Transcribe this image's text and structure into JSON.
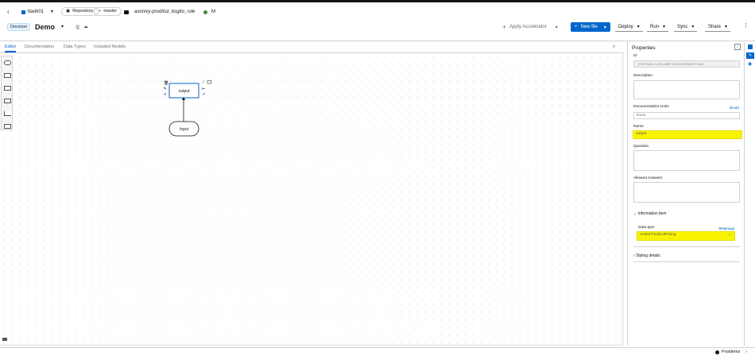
{
  "header": {
    "back_icon": "chevron-left-icon",
    "user": "ttanh01",
    "repo_label": "Repository",
    "branch": "master",
    "path": "axonivy-prod/luz_kogito_rule",
    "status_icon": "check-circle-icon",
    "status_text": "M"
  },
  "file": {
    "type_badge": "Decision",
    "name": "Demo"
  },
  "toolbar": {
    "apply_accelerator": "Apply Accelerator",
    "new_file": "New file",
    "deploy": "Deploy",
    "run": "Run",
    "sync": "Sync",
    "share": "Share"
  },
  "tabs": [
    "Editor",
    "Documentation",
    "Data Types",
    "Included Models"
  ],
  "diagram": {
    "decision_label": "output",
    "input_label": "Input"
  },
  "properties": {
    "title": "Properties",
    "id_label": "Id",
    "id_value": "_E3EF9481-1CD6-48BF-AD93-B2B65A7F3184",
    "description_label": "Description",
    "doc_links_label": "Documentation Links",
    "add_label": "Add",
    "doc_links_value": "None",
    "name_label": "Name",
    "name_value": "output",
    "question_label": "Question",
    "allowed_answers_label": "Allowed Answers",
    "info_item_label": "Information item",
    "data_type_label": "Data type",
    "manage_label": "Manage",
    "data_type_value": "model.ProductPricing",
    "styling_label": "Styling details"
  },
  "footer": {
    "problems_label": "Problems"
  },
  "colors": {
    "accent": "#0066cc",
    "highlight": "#f8f400"
  }
}
